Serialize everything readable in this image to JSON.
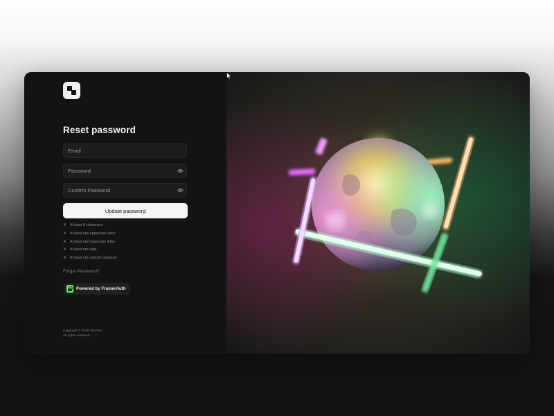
{
  "form": {
    "title": "Reset password",
    "email_placeholder": "Email",
    "password_placeholder": "Password",
    "confirm_placeholder": "Confirm Password",
    "submit_label": "Update password"
  },
  "requirements": [
    "At least 8 characters",
    "At least one uppercase letter",
    "At least one lowercase letter",
    "At least one digit",
    "At least one special character"
  ],
  "links": {
    "forgot": "Forgot Password?"
  },
  "badge": {
    "label": "Powered by FramerAuth"
  },
  "footer": {
    "copyright": "Copyright © 2025 Vendeur.",
    "rights": "All rights reserved."
  },
  "icons": {
    "logo": "logo-icon",
    "eye": "eye-icon",
    "requirement": "x-icon",
    "badge": "lock-icon",
    "cursor": "mouse-cursor-icon"
  },
  "colors": {
    "panel_bg": "#131314",
    "field_bg": "#1d1d1f",
    "button_bg": "#f4f4f4",
    "badge_accent": "#6ee35b"
  }
}
